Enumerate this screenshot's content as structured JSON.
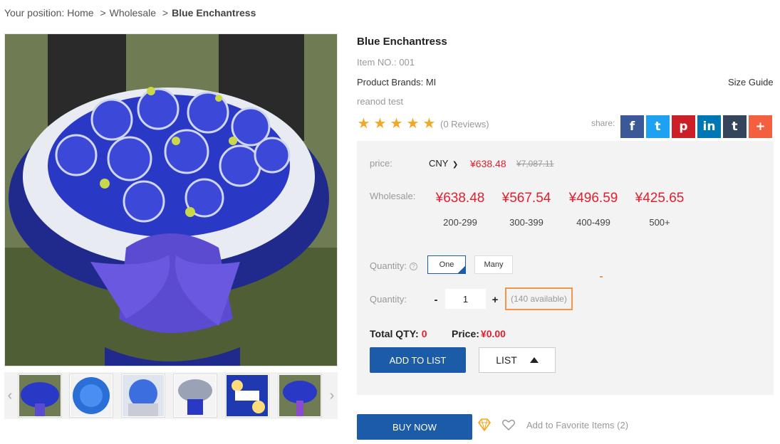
{
  "breadcrumb": {
    "prefix": "Your position:",
    "home": "Home",
    "category": "Wholesale",
    "current": "Blue Enchantress",
    "separator": ">"
  },
  "product": {
    "title": "Blue Enchantress",
    "item_no": "Item NO.: 001",
    "brand": "Product Brands: MI",
    "size_guide": "Size Guide",
    "description": "reanod test",
    "rating_stars": 5,
    "reviews": "(0 Reviews)",
    "image_icon": "blue-rose-bouquet-image",
    "thumbnail_count": 6
  },
  "share": {
    "label": "share:",
    "buttons": [
      {
        "icon": "facebook-icon",
        "glyph": "f",
        "color": "#3b5998"
      },
      {
        "icon": "twitter-icon",
        "glyph": "t",
        "color": "#1da1f2"
      },
      {
        "icon": "pinterest-icon",
        "glyph": "p",
        "color": "#cb2027"
      },
      {
        "icon": "linkedin-icon",
        "glyph": "in",
        "color": "#0077b5"
      },
      {
        "icon": "tumblr-icon",
        "glyph": "t",
        "color": "#35465c"
      },
      {
        "icon": "more-share-icon",
        "glyph": "+",
        "color": "#f4603f"
      }
    ]
  },
  "pricing": {
    "price_label": "price:",
    "currency": "CNY",
    "price_now": "¥638.48",
    "price_old": "¥7,087.11",
    "wholesale_label": "Wholesale:",
    "tiers": [
      {
        "price": "¥638.48",
        "range": "200-299"
      },
      {
        "price": "¥567.54",
        "range": "300-399"
      },
      {
        "price": "¥496.59",
        "range": "400-499"
      },
      {
        "price": "¥425.65",
        "range": "500+"
      }
    ],
    "accent_color": "#e0202f"
  },
  "quantity": {
    "mode_label": "Quantity:",
    "mode_help": "?",
    "mode_one": "One",
    "mode_many": "Many",
    "qty_label": "Quantity:",
    "minus": "-",
    "value": "1",
    "plus": "+",
    "available": "(140 available)"
  },
  "totals": {
    "qty_label": "Total QTY:",
    "qty_value": "0",
    "price_label": "Price:",
    "price_value": "¥0.00"
  },
  "actions": {
    "add_to_list": "ADD TO LIST",
    "list": "LIST",
    "buy_now": "BUY NOW",
    "favorite": "Add to Favorite Items (2)",
    "brand_color": "#1c5ba8"
  }
}
